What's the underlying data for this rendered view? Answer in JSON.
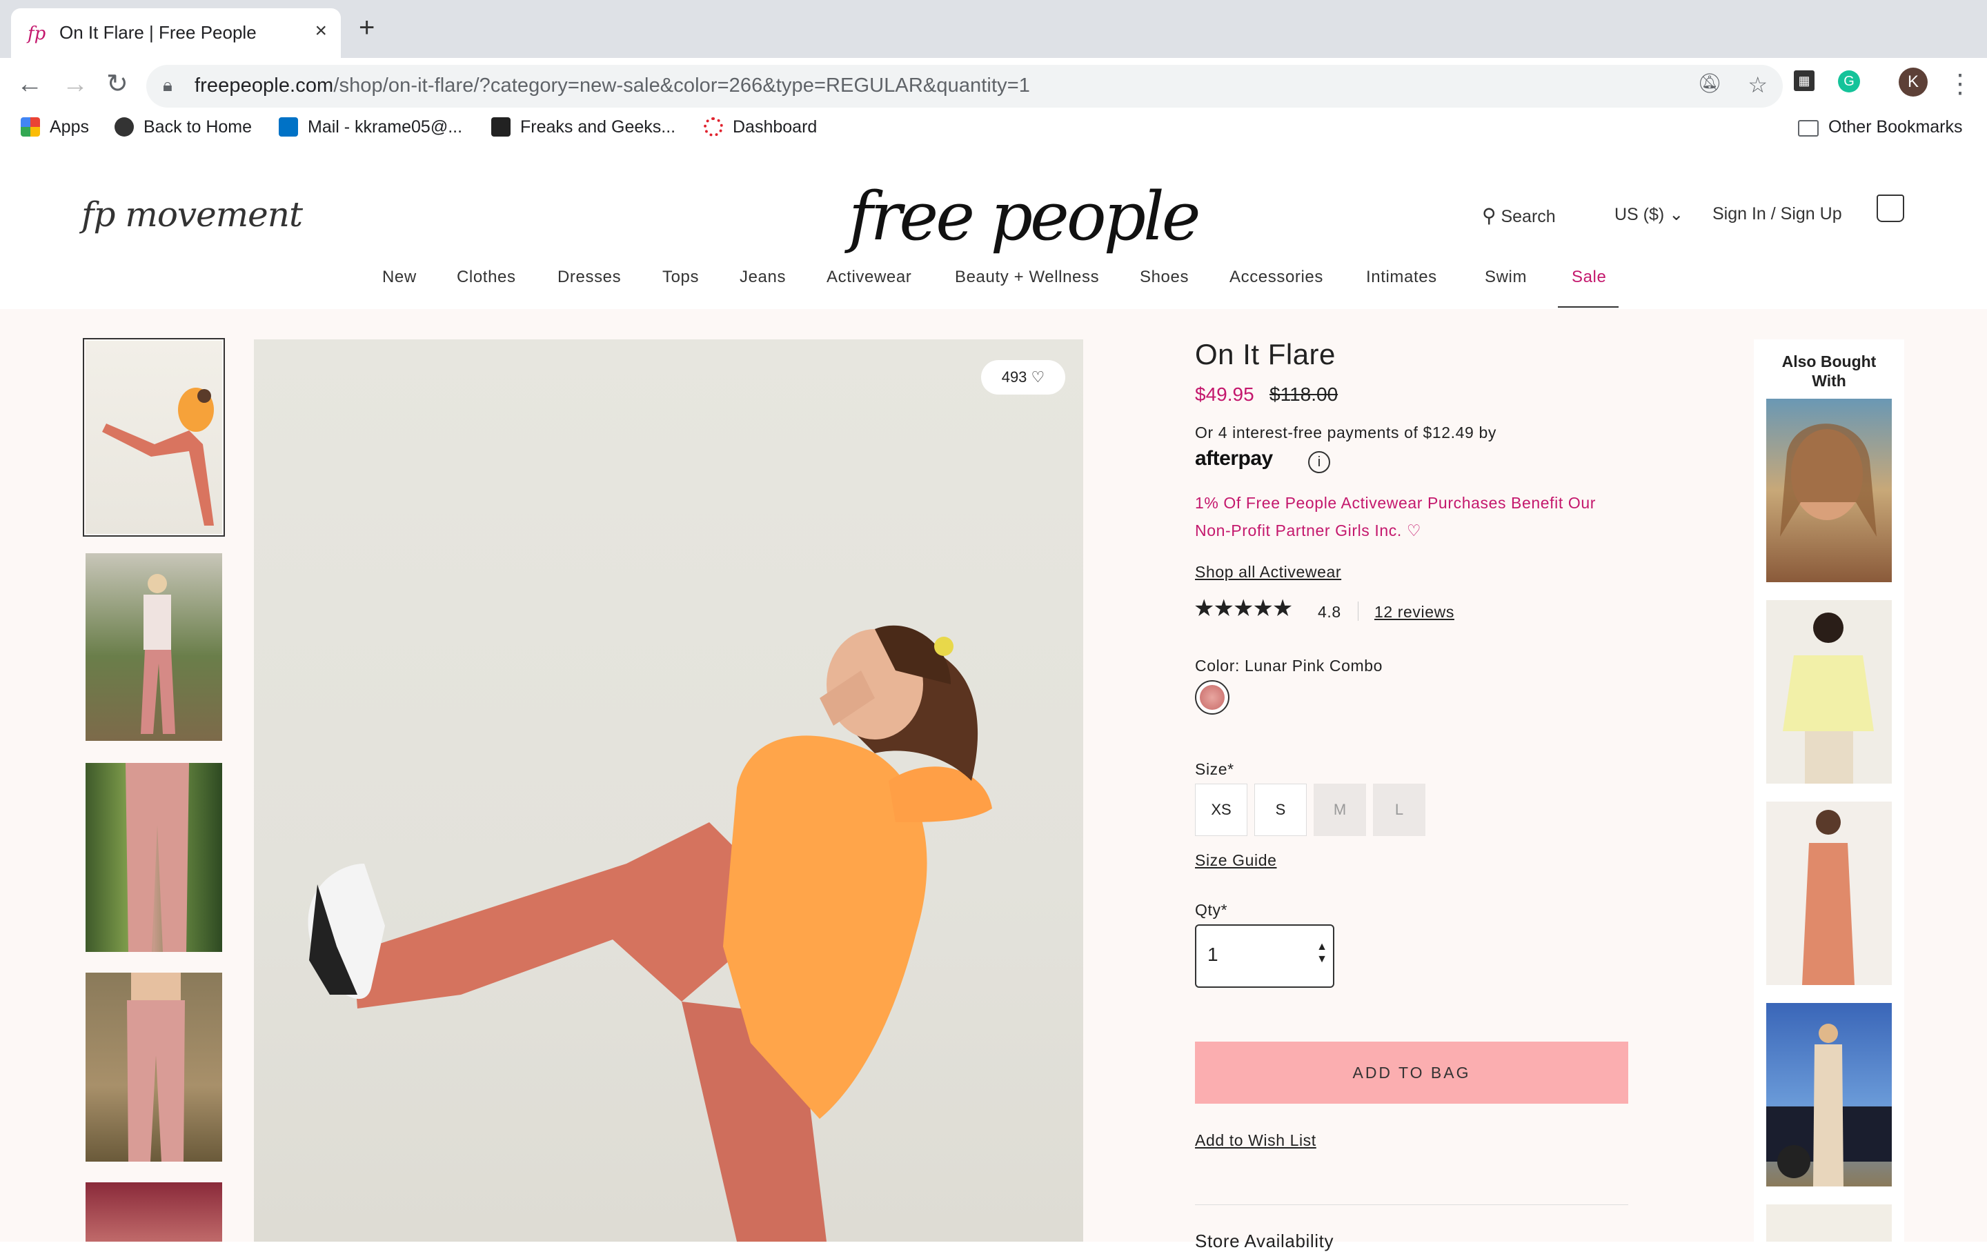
{
  "browser": {
    "tab_title": "On It Flare | Free People",
    "url_domain": "freepeople.com",
    "url_path": "/shop/on-it-flare/?category=new-sale&color=266&type=REGULAR&quantity=1",
    "profile_initial": "K",
    "bookmarks": [
      "Apps",
      "Back to Home",
      "Mail - kkrame05@...",
      "Freaks and Geeks...",
      "Dashboard"
    ],
    "other_bookmarks": "Other Bookmarks"
  },
  "header": {
    "logo_left": "fp movement",
    "logo_main": "free people",
    "search": "Search",
    "currency": "US ($)",
    "account": "Sign In / Sign Up",
    "categories": [
      "New",
      "Clothes",
      "Dresses",
      "Tops",
      "Jeans",
      "Activewear",
      "Beauty + Wellness",
      "Shoes",
      "Accessories",
      "Intimates",
      "Swim",
      "Sale"
    ]
  },
  "gallery": {
    "likes": "493"
  },
  "product": {
    "title": "On It Flare",
    "price": "$49.95",
    "original_price": "$118.00",
    "installments": "Or 4 interest-free payments of $12.49 by",
    "afterpay": "afterpay",
    "charity_line1": "1% Of Free People Activewear Purchases Benefit Our",
    "charity_line2": "Non-Profit Partner Girls Inc. ♡",
    "shop_all": "Shop all Activewear",
    "rating": "4.8",
    "reviews": "12 reviews",
    "color_label": "Color: Lunar Pink Combo",
    "size_label": "Size*",
    "sizes": [
      "XS",
      "S",
      "M",
      "L"
    ],
    "size_guide": "Size Guide",
    "qty_label": "Qty*",
    "qty_value": "1",
    "add_to_bag": "ADD TO BAG",
    "wishlist": "Add to Wish List",
    "store_availability": "Store Availability"
  },
  "also_bought": {
    "title_line1": "Also Bought",
    "title_line2": "With"
  },
  "colors": {
    "brand_pink": "#c4186d",
    "add_bag": "#fbaeb0",
    "page_bg": "#fdf8f6"
  }
}
